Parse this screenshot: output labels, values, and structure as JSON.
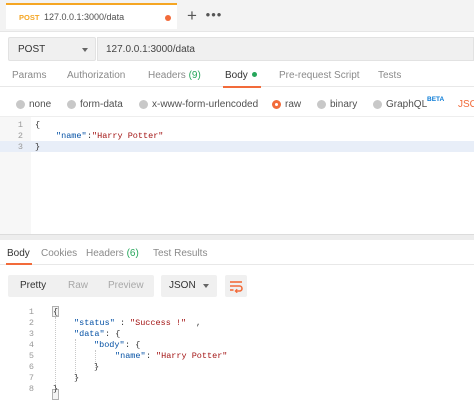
{
  "tab": {
    "method": "POST",
    "url": "127.0.0.1:3000/data",
    "plus_label": "+",
    "more_label": "•••"
  },
  "request": {
    "method": "POST",
    "url": "127.0.0.1:3000/data"
  },
  "request_tabs": {
    "params": "Params",
    "authorization": "Authorization",
    "headers": "Headers",
    "headers_count": "(9)",
    "body": "Body",
    "prerequest": "Pre-request Script",
    "tests": "Tests"
  },
  "body_options": {
    "none": "none",
    "form_data": "form-data",
    "urlencoded": "x-www-form-urlencoded",
    "raw": "raw",
    "binary": "binary",
    "graphql": "GraphQL",
    "beta": "BETA",
    "format": "JSO",
    "selected": "raw"
  },
  "request_body": {
    "line_numbers": [
      "1",
      "2",
      "3"
    ],
    "open": "{",
    "key": "\"name\"",
    "colon": ":",
    "value": "\"Harry Potter\"",
    "close": "}"
  },
  "response_tabs": {
    "body": "Body",
    "cookies": "Cookies",
    "headers": "Headers",
    "headers_count": "(6)",
    "test_results": "Test Results"
  },
  "response_view": {
    "pretty": "Pretty",
    "raw": "Raw",
    "preview": "Preview",
    "format": "JSON"
  },
  "response_body": {
    "line_numbers": [
      "1",
      "2",
      "3",
      "4",
      "5",
      "6",
      "7",
      "8"
    ],
    "l1": "{",
    "l2_key": "\"status\"",
    "l2_rest": ": ",
    "l2_val": "\"Success !\"",
    "l2_end": ",",
    "l3_key": "\"data\"",
    "l3_rest": ": {",
    "l4_key": "\"body\"",
    "l4_rest": ": {",
    "l5_key": "\"name\"",
    "l5_rest": ": ",
    "l5_val": "\"Harry Potter\"",
    "l6": "}",
    "l7": "}",
    "l8": "}"
  },
  "colors": {
    "accent": "#f26b3a",
    "tab_method": "#f5a623",
    "success_green": "#26a65b",
    "beta_blue": "#0a7bd6"
  }
}
